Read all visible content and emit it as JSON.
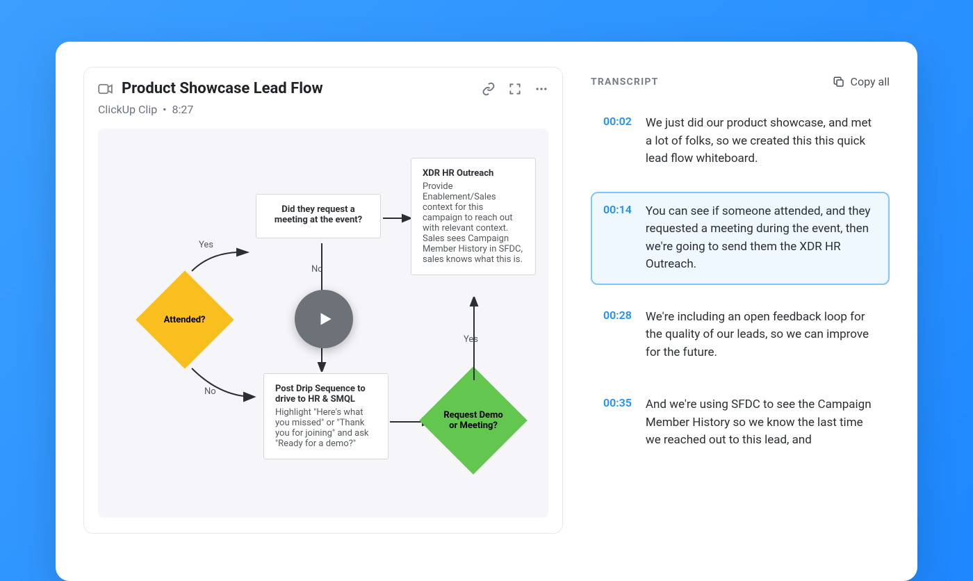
{
  "video": {
    "title": "Product Showcase Lead Flow",
    "source": "ClickUp Clip",
    "separator": "•",
    "duration": "8:27"
  },
  "flow": {
    "attended": "Attended?",
    "yes1": "Yes",
    "no1": "No",
    "request_meeting": "Did they request a meeting at the event?",
    "no2": "No",
    "xdr_title": "XDR HR Outreach",
    "xdr_body": "Provide Enablement/Sales context for this campaign to reach out with relevant context. Sales sees Campaign Member History in SFDC, sales knows what this is.",
    "post_drip_title": "Post Drip Sequence to drive to HR & SMQL",
    "post_drip_body": "Highlight \"Here's what you missed\" or \"Thank you for joining\" and ask \"Ready for a demo?\"",
    "demo_diamond": "Request Demo or Meeting?",
    "yes2": "Yes"
  },
  "transcript": {
    "heading": "TRANSCRIPT",
    "copy_label": "Copy all",
    "items": [
      {
        "time": "00:02",
        "text": "We just did our product showcase, and met a lot of folks, so we created this this quick lead flow whiteboard.",
        "active": false
      },
      {
        "time": "00:14",
        "text": "You can see if someone attended, and they requested a meeting during the event, then we're going to send them the XDR HR Outreach.",
        "active": true
      },
      {
        "time": "00:28",
        "text": "We're including an open feedback loop for the quality of our leads, so we can improve for the future.",
        "active": false
      },
      {
        "time": "00:35",
        "text": "And we're using SFDC to see the Campaign Member History so we know the last time we reached out to this lead, and",
        "active": false
      }
    ]
  }
}
